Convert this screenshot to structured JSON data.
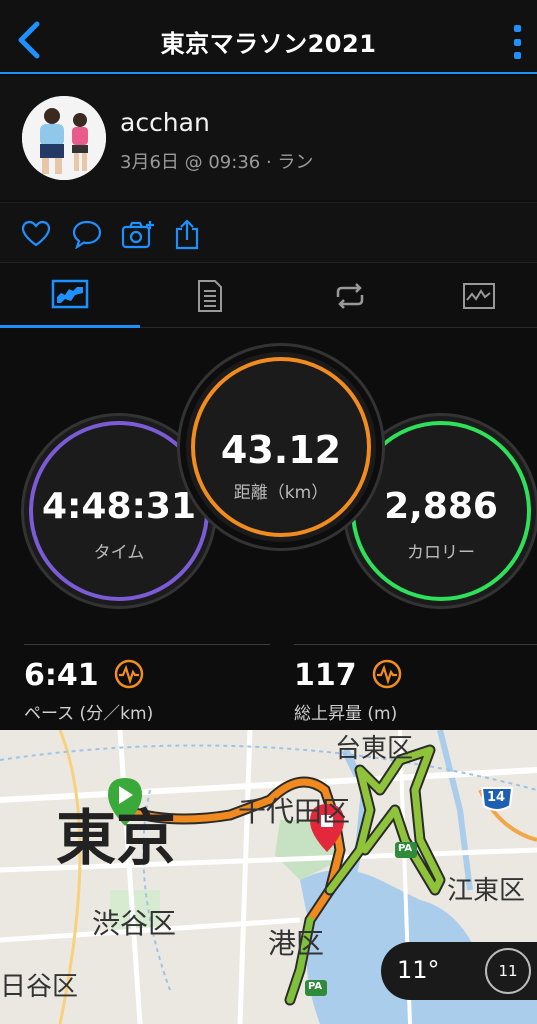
{
  "header": {
    "title": "東京マラソン2021"
  },
  "profile": {
    "username": "acchan",
    "subtitle": "3月6日 @ 09:36 · ラン"
  },
  "stats": {
    "time": {
      "value": "4:48:31",
      "label": "タイム",
      "color": "#7b5cd6"
    },
    "distance": {
      "value": "43.12",
      "label": "距離（km）",
      "color": "#f28c1e"
    },
    "calories": {
      "value": "2,886",
      "label": "カロリー",
      "color": "#2ee05a"
    },
    "pace": {
      "value": "6:41",
      "label": "ペース (分／km)"
    },
    "elevation": {
      "value": "117",
      "label": "総上昇量 (m)"
    }
  },
  "map": {
    "labels": {
      "tokyo": "東京",
      "taito": "台東区",
      "chiyoda": "千代田区",
      "koto": "江東区",
      "shibuya": "渋谷区",
      "minato": "港区",
      "setagaya": "日谷区"
    },
    "shields": {
      "route14": "14",
      "pa1": "PA",
      "pa2": "PA"
    },
    "weather": {
      "temperature": "11°",
      "wind": "11"
    }
  },
  "colors": {
    "accent": "#1e90ff",
    "warning": "#f28c1e"
  }
}
